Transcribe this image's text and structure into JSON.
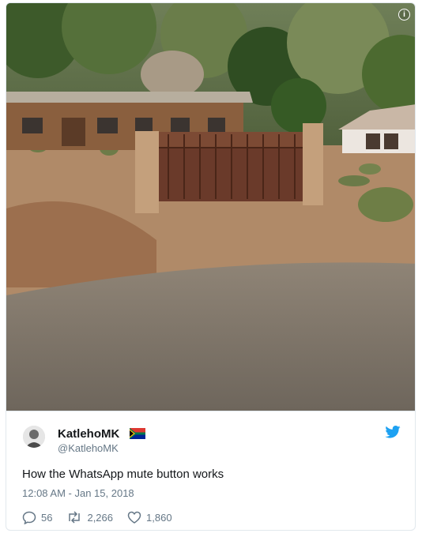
{
  "tweet": {
    "media_alt": "",
    "display_name": "KatlehoMK",
    "handle": "@KatlehoMK",
    "text": "How the WhatsApp mute button works",
    "timestamp": "12:08 AM - Jan 15, 2018",
    "replies": "56",
    "retweets": "2,266",
    "likes": "1,860",
    "flag_icon": "south-africa-flag-icon",
    "brand_icon": "twitter-bird-icon",
    "accent_color": "#1da1f2"
  }
}
